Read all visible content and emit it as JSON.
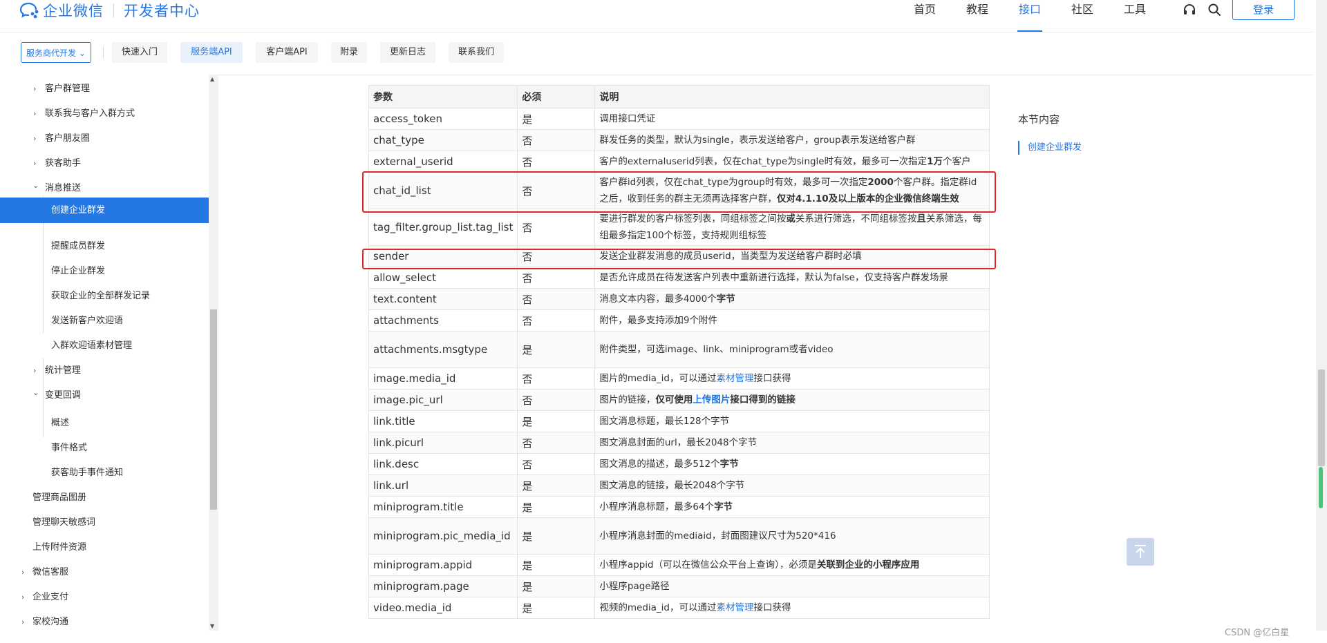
{
  "header": {
    "logo_text": "企业微信",
    "logo_sub": "开发者中心",
    "nav": [
      "首页",
      "教程",
      "接口",
      "社区",
      "工具"
    ],
    "active_nav": "接口",
    "login_label": "登录",
    "accent": "#2478e4"
  },
  "subnav": {
    "dropdown_label": "服务商代开发",
    "tabs": [
      "快速入门",
      "服务端API",
      "客户端API",
      "附录",
      "更新日志",
      "联系我们"
    ],
    "active_tab": "服务端API"
  },
  "sidebar": {
    "items": [
      {
        "label": "客户群管理",
        "arrow": "›"
      },
      {
        "label": "联系我与客户入群方式",
        "arrow": "›"
      },
      {
        "label": "客户朋友圈",
        "arrow": "›"
      },
      {
        "label": "获客助手",
        "arrow": "›"
      },
      {
        "label": "消息推送",
        "arrow": "⌄"
      },
      {
        "label": "创建企业群发",
        "active": true
      },
      {
        "label": "提醒成员群发"
      },
      {
        "label": "停止企业群发"
      },
      {
        "label": "获取企业的全部群发记录"
      },
      {
        "label": "发送新客户欢迎语"
      },
      {
        "label": "入群欢迎语素材管理"
      },
      {
        "label": "统计管理",
        "arrow": "›"
      },
      {
        "label": "变更回调",
        "arrow": "⌄"
      },
      {
        "label": "概述"
      },
      {
        "label": "事件格式"
      },
      {
        "label": "获客助手事件通知"
      },
      {
        "label": "管理商品图册"
      },
      {
        "label": "管理聊天敏感词"
      },
      {
        "label": "上传附件资源"
      },
      {
        "label": "微信客服",
        "arrow": "›"
      },
      {
        "label": "企业支付",
        "arrow": "›"
      },
      {
        "label": "家校沟通",
        "arrow": "›"
      }
    ]
  },
  "table": {
    "headers": [
      "参数",
      "必须",
      "说明"
    ],
    "rows": [
      {
        "p": "access_token",
        "r": "是",
        "d": "调用接口凭证"
      },
      {
        "p": "chat_type",
        "r": "否",
        "d": "群发任务的类型，默认为single，表示发送给客户，group表示发送给客户群"
      },
      {
        "p": "external_userid",
        "r": "否",
        "d": "客户的externaluserid列表，仅在chat_type为single时有效，最多可一次指定",
        "b": "1万",
        "d2": "个客户"
      },
      {
        "p": "chat_id_list",
        "r": "否",
        "d": "客户群id列表，仅在chat_type为group时有效，最多可一次指定",
        "b": "2000",
        "d2": "个客户群。指定群id之后，收到任务的群主无须再选择客户群，",
        "b2": "仅对4.1.10及以上版本的企业微信终端生效"
      },
      {
        "p": "tag_filter.group_list.tag_list",
        "r": "否",
        "d": "要进行群发的客户标签列表，同组标签之间按",
        "b": "或",
        "d2": "关系进行筛选，不同组标签按",
        "b2": "且",
        "d3": "关系筛选，每组最多指定100个标签，支持规则组标签"
      },
      {
        "p": "sender",
        "r": "否",
        "d": "发送企业群发消息的成员userid，当类型为发送给客户群时必填"
      },
      {
        "p": "allow_select",
        "r": "否",
        "d": "是否允许成员在待发送客户列表中重新进行选择，默认为false，仅支持客户群发场景"
      },
      {
        "p": "text.content",
        "r": "否",
        "d": "消息文本内容，最多4000个",
        "b": "字节"
      },
      {
        "p": "attachments",
        "r": "否",
        "d": "附件，最多支持添加9个附件"
      },
      {
        "p": "attachments.msgtype",
        "r": "是",
        "d": "附件类型，可选image、link、miniprogram或者video"
      },
      {
        "p": "image.media_id",
        "r": "否",
        "d": "图片的media_id，可以通过",
        "l": "素材管理",
        "d2": "接口获得"
      },
      {
        "p": "image.pic_url",
        "r": "否",
        "d": "图片的链接，",
        "b": "仅可使用",
        "l": "上传图片",
        "b2": "接口得到的链接"
      },
      {
        "p": "link.title",
        "r": "是",
        "d": "图文消息标题，最长128个字节"
      },
      {
        "p": "link.picurl",
        "r": "否",
        "d": "图文消息封面的url，最长2048个字节"
      },
      {
        "p": "link.desc",
        "r": "否",
        "d": "图文消息的描述，最多512个",
        "b": "字节"
      },
      {
        "p": "link.url",
        "r": "是",
        "d": "图文消息的链接，最长2048个字节"
      },
      {
        "p": "miniprogram.title",
        "r": "是",
        "d": "小程序消息标题，最多64个",
        "b": "字节"
      },
      {
        "p": "miniprogram.pic_media_id",
        "r": "是",
        "d": "小程序消息封面的mediaid，封面图建议尺寸为520*416"
      },
      {
        "p": "miniprogram.appid",
        "r": "是",
        "d": "小程序appid（可以在微信公众平台上查询），必须是",
        "b": "关联到企业的小程序应用"
      },
      {
        "p": "miniprogram.page",
        "r": "是",
        "d": "小程序page路径"
      },
      {
        "p": "video.media_id",
        "r": "是",
        "d": "视频的media_id，可以通过",
        "l": "素材管理",
        "d2": "接口获得"
      }
    ],
    "highlighted_rows": [
      "chat_id_list",
      "sender"
    ],
    "highlight_color": "#e0262b"
  },
  "toc": {
    "title": "本节内容",
    "items": [
      "创建企业群发"
    ]
  },
  "watermark": "CSDN @亿白星"
}
